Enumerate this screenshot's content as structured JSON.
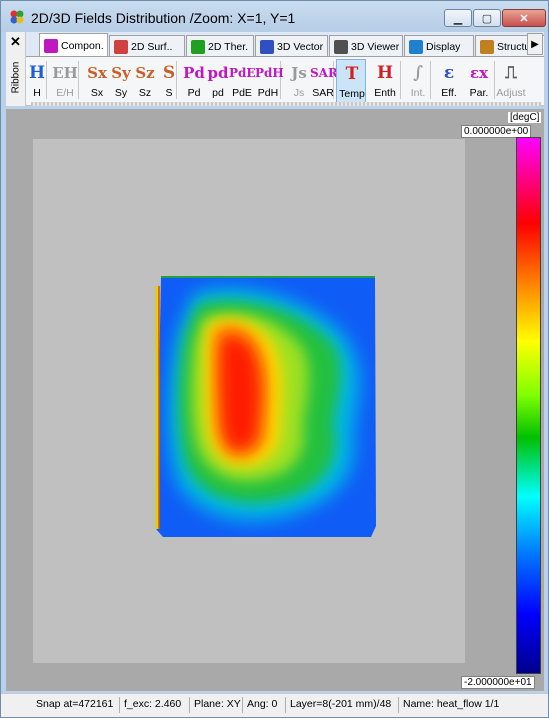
{
  "window": {
    "title": "2D/3D Fields Distribution /Zoom: X=1, Y=1",
    "min_label": "▁",
    "max_label": "▢",
    "close_label": "✕"
  },
  "ribbon": {
    "close_label": "✕",
    "side_label": "Ribbon"
  },
  "tabs": [
    {
      "label": "Compon.",
      "icon": "field-e-icon",
      "color": "#c018c0",
      "active": true
    },
    {
      "label": "2D Surf..",
      "icon": "surface-icon",
      "color": "#d04040",
      "active": false
    },
    {
      "label": "2D Ther.",
      "icon": "thermal-icon",
      "color": "#20a020",
      "active": false
    },
    {
      "label": "3D Vector",
      "icon": "vector-icon",
      "color": "#3050c0",
      "active": false
    },
    {
      "label": "3D Viewer",
      "icon": "viewer-icon",
      "color": "#505050",
      "active": false
    },
    {
      "label": "Display",
      "icon": "display-icon",
      "color": "#2080d0",
      "active": false
    },
    {
      "label": "Structure",
      "icon": "structure-icon",
      "color": "#c08020",
      "active": false
    }
  ],
  "tab_scroll_label": "▶",
  "toolbar": [
    {
      "glyph": "H",
      "label": "H",
      "color": "#1e5fd8",
      "selected": false,
      "disabled": false
    },
    {
      "glyph": "EH",
      "label": "E/H",
      "color": "#9a9a9a",
      "selected": false,
      "disabled": true
    },
    {
      "glyph": "Sx",
      "label": "Sx",
      "color": "#c8602a",
      "selected": false,
      "disabled": false
    },
    {
      "glyph": "Sy",
      "label": "Sy",
      "color": "#c8602a",
      "selected": false,
      "disabled": false
    },
    {
      "glyph": "Sz",
      "label": "Sz",
      "color": "#c8602a",
      "selected": false,
      "disabled": false
    },
    {
      "glyph": "S",
      "label": "S",
      "color": "#c8602a",
      "selected": false,
      "disabled": false
    },
    {
      "glyph": "Pd",
      "label": "Pd",
      "color": "#c018c0",
      "selected": false,
      "disabled": false
    },
    {
      "glyph": "pd",
      "label": "pd",
      "color": "#c018c0",
      "selected": false,
      "disabled": false
    },
    {
      "glyph": "PdE",
      "label": "PdE",
      "color": "#c018c0",
      "selected": false,
      "disabled": false
    },
    {
      "glyph": "PdH",
      "label": "PdH",
      "color": "#c018c0",
      "selected": false,
      "disabled": false
    },
    {
      "glyph": "Js",
      "label": "Js",
      "color": "#9a9a9a",
      "selected": false,
      "disabled": true
    },
    {
      "glyph": "SAR",
      "label": "SAR",
      "color": "#c018c0",
      "selected": false,
      "disabled": false
    },
    {
      "glyph": "T",
      "label": "Temp",
      "color": "#d02020",
      "selected": true,
      "disabled": false
    },
    {
      "glyph": "H",
      "label": "Enth",
      "color": "#d02020",
      "selected": false,
      "disabled": false
    },
    {
      "glyph": "∫",
      "label": "Int.",
      "color": "#9a9a9a",
      "selected": false,
      "disabled": true
    },
    {
      "glyph": "ε",
      "label": "Eff.",
      "color": "#3050c0",
      "selected": false,
      "disabled": false
    },
    {
      "glyph": "εx",
      "label": "Par.",
      "color": "#c018c0",
      "selected": false,
      "disabled": false
    },
    {
      "glyph": "⎍",
      "label": "Adjust",
      "color": "#606060",
      "selected": false,
      "disabled": true
    }
  ],
  "colorbar": {
    "unit": "[degC]",
    "max": "0.000000e+00",
    "min": "-2.000000e+01"
  },
  "status": {
    "snap": "Snap at=472161",
    "fexc": "f_exc:  2.460",
    "plane": "Plane: XY",
    "ang": "Ang:   0",
    "layer": "Layer=8(-201 mm)/48",
    "name": "Name: heat_flow 1/1"
  }
}
